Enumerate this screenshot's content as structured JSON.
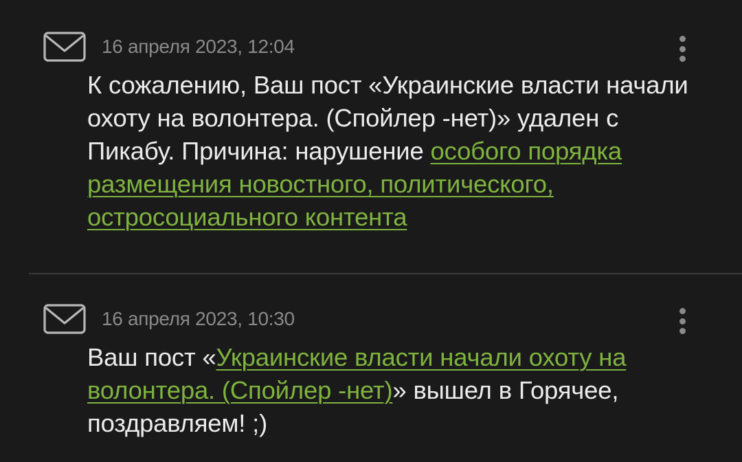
{
  "notifications": [
    {
      "icon": "mail-icon",
      "timestamp": "16 апреля 2023, 12:04",
      "message": {
        "text_before": "К сожалению, Ваш пост «Украинские власти начали охоту на волонтера. (Спойлер -нет)» удален с Пикабу. Причина: нарушение ",
        "link_text": "особого порядка размещения новостного, политического, остросоциального контента",
        "text_after": ""
      }
    },
    {
      "icon": "mail-icon",
      "timestamp": "16 апреля 2023, 10:30",
      "message": {
        "text_before": "Ваш пост «",
        "link_text": "Украинские власти начали охоту на волонтера. (Спойлер -нет)",
        "text_after": "» вышел в Горячее, поздравляем! ;)"
      }
    }
  ],
  "colors": {
    "background": "#1a1a1a",
    "text": "#ececec",
    "timestamp": "#8a8a8a",
    "link": "#7fb33f",
    "divider": "#3a3a3a"
  }
}
